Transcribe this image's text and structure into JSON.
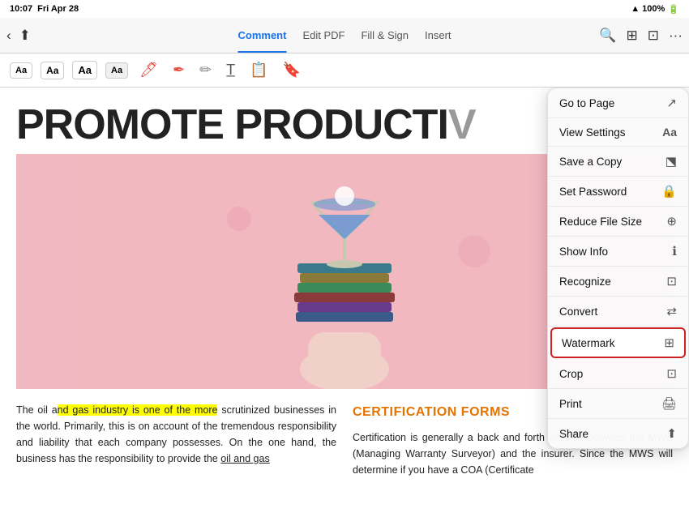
{
  "status_bar": {
    "time": "10:07",
    "day": "Fri Apr 28",
    "wifi": "100%",
    "battery": "🔋"
  },
  "toolbar": {
    "tabs": [
      "Comment",
      "Edit PDF",
      "Fill & Sign",
      "Insert"
    ],
    "active_tab": "Comment"
  },
  "annotation_tools": {
    "text_sizes": [
      "Aa",
      "Aa",
      "Aa",
      "Aa"
    ]
  },
  "pdf": {
    "title": "PROMOTE PRODUCTI…",
    "paragraph1": "The oil and gas industry is one of the more scrutinized businesses in the world. Primarily, this is on account of the tremendous responsibility and liability that each company possesses. On the one hand, the business has the responsibility to provide the oil and gas",
    "highlight_phrase": "nd gas industry is one of the more",
    "col2_title": "CERTIFICATION FORMS",
    "paragraph2": "Certification is generally a back and forth of fixes between the MWS (Managing Warranty Surveyor) and the insurer. Since the MWS will determine if you have a COA (Certificate"
  },
  "menu": {
    "items": [
      {
        "label": "Go to Page",
        "icon": "⤴",
        "id": "go-to-page"
      },
      {
        "label": "View Settings",
        "icon": "Aa",
        "id": "view-settings"
      },
      {
        "label": "Save a Copy",
        "icon": "⎘",
        "id": "save-copy"
      },
      {
        "label": "Set Password",
        "icon": "🔒",
        "id": "set-password"
      },
      {
        "label": "Reduce File Size",
        "icon": "⊕",
        "id": "reduce-size"
      },
      {
        "label": "Show Info",
        "icon": "ⓘ",
        "id": "show-info"
      },
      {
        "label": "Recognize",
        "icon": "⊡",
        "id": "recognize"
      },
      {
        "label": "Convert",
        "icon": "⇄",
        "id": "convert"
      },
      {
        "label": "Watermark",
        "icon": "⊞",
        "id": "watermark",
        "selected": true
      },
      {
        "label": "Crop",
        "icon": "⊡",
        "id": "crop"
      },
      {
        "label": "Print",
        "icon": "🖨",
        "id": "print"
      },
      {
        "label": "Share",
        "icon": "⎋",
        "id": "share"
      }
    ]
  }
}
